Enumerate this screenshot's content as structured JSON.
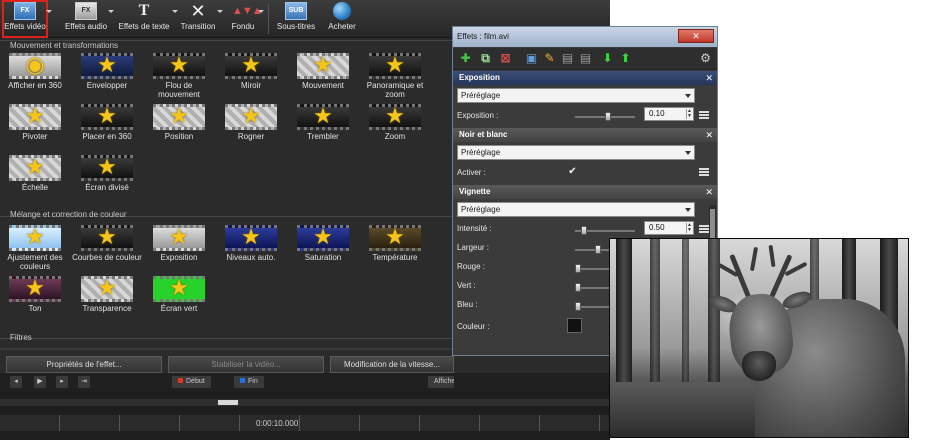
{
  "toolbar": {
    "items": [
      {
        "label": "Effets vidéo",
        "icon": "video-effects-icon",
        "icon_text": "FX",
        "active": true
      },
      {
        "label": "Effets audio",
        "icon": "audio-effects-icon",
        "icon_text": "FX"
      },
      {
        "label": "Effets de texte",
        "icon": "text-effects-icon",
        "icon_text": "T"
      },
      {
        "label": "Transition",
        "icon": "transition-icon",
        "icon_text": "✕"
      },
      {
        "label": "Fondu",
        "icon": "fade-icon",
        "icon_text": "▲▼▲"
      },
      {
        "label": "Sous-titres",
        "icon": "subtitles-icon",
        "icon_text": "SUB"
      },
      {
        "label": "Acheter",
        "icon": "buy-globe-icon",
        "icon_text": ""
      }
    ],
    "active_color": "#e0211b"
  },
  "sections": {
    "motion": {
      "title": "Mouvement et transformations",
      "items": [
        {
          "label": "Afficher en 360",
          "bg": "bg-grey",
          "glyph": "◉"
        },
        {
          "label": "Envelopper",
          "bg": "bg-blue",
          "glyph": "★"
        },
        {
          "label": "Flou de mouvement",
          "bg": "bg-dark",
          "glyph": "★"
        },
        {
          "label": "Miroir",
          "bg": "bg-dark",
          "glyph": "★"
        },
        {
          "label": "Mouvement",
          "bg": "bg-check",
          "glyph": "★"
        },
        {
          "label": "Panoramique et zoom",
          "bg": "bg-dark",
          "glyph": "★"
        },
        {
          "label": "Pivoter",
          "bg": "bg-check",
          "glyph": "★"
        },
        {
          "label": "Placer en 360",
          "bg": "bg-dark",
          "glyph": "★"
        },
        {
          "label": "Position",
          "bg": "bg-check",
          "glyph": "★"
        },
        {
          "label": "Rogner",
          "bg": "bg-check",
          "glyph": "★"
        },
        {
          "label": "Trembler",
          "bg": "bg-dark",
          "glyph": "★"
        },
        {
          "label": "Zoom",
          "bg": "bg-dark",
          "glyph": "★"
        },
        {
          "label": "Échelle",
          "bg": "bg-check",
          "glyph": "★"
        },
        {
          "label": "Écran divisé",
          "bg": "bg-dark",
          "glyph": "★"
        }
      ]
    },
    "color": {
      "title": "Mélange et correction de couleur",
      "items": [
        {
          "label": "Ajustement des couleurs",
          "bg": "bg-sky",
          "glyph": "★"
        },
        {
          "label": "Courbes de couleur",
          "bg": "bg-dark",
          "glyph": "★"
        },
        {
          "label": "Exposition",
          "bg": "bg-grey",
          "glyph": "★"
        },
        {
          "label": "Niveaux auto.",
          "bg": "bg-navy",
          "glyph": "★"
        },
        {
          "label": "Saturation",
          "bg": "bg-navy",
          "glyph": "★"
        },
        {
          "label": "Température",
          "bg": "bg-warm",
          "glyph": "★"
        },
        {
          "label": "Ton",
          "bg": "bg-pink",
          "glyph": "★"
        },
        {
          "label": "Transparence",
          "bg": "bg-check",
          "glyph": "★"
        },
        {
          "label": "Écran vert",
          "bg": "bg-green",
          "glyph": "★"
        }
      ]
    },
    "filters": {
      "title": "Filtres"
    }
  },
  "actions": {
    "properties": "Propriétés de l'effet...",
    "stabilize": "Stabiliser la vidéo...",
    "speed": "Modification de la vitesse..."
  },
  "transport": {
    "start_label": "Début",
    "end_label": "Fin",
    "right_label": "Afficher",
    "start_color": "#d23a2a",
    "end_color": "#2a6fd2"
  },
  "timeline": {
    "time": "0:00:10.000"
  },
  "effects_panel": {
    "title": "Effets : film.avi",
    "close": "✕",
    "groups": {
      "exposure": {
        "title": "Exposition",
        "preset": "Préréglage",
        "prop_label": "Exposition :",
        "value": "0.10",
        "slider_level": 0.55
      },
      "bw": {
        "title": "Noir et blanc",
        "preset": "Préréglage",
        "prop_label": "Activer :",
        "checked": "✔"
      },
      "vignette": {
        "title": "Vignette",
        "preset": "Préréglage",
        "intensity_label": "Intensité :",
        "intensity_value": "0.50",
        "width_label": "Largeur :",
        "red_label": "Rouge :",
        "green_label": "Vert :",
        "blue_label": "Bleu :",
        "color_label": "Couleur :",
        "swatch_color": "#111111"
      }
    }
  }
}
